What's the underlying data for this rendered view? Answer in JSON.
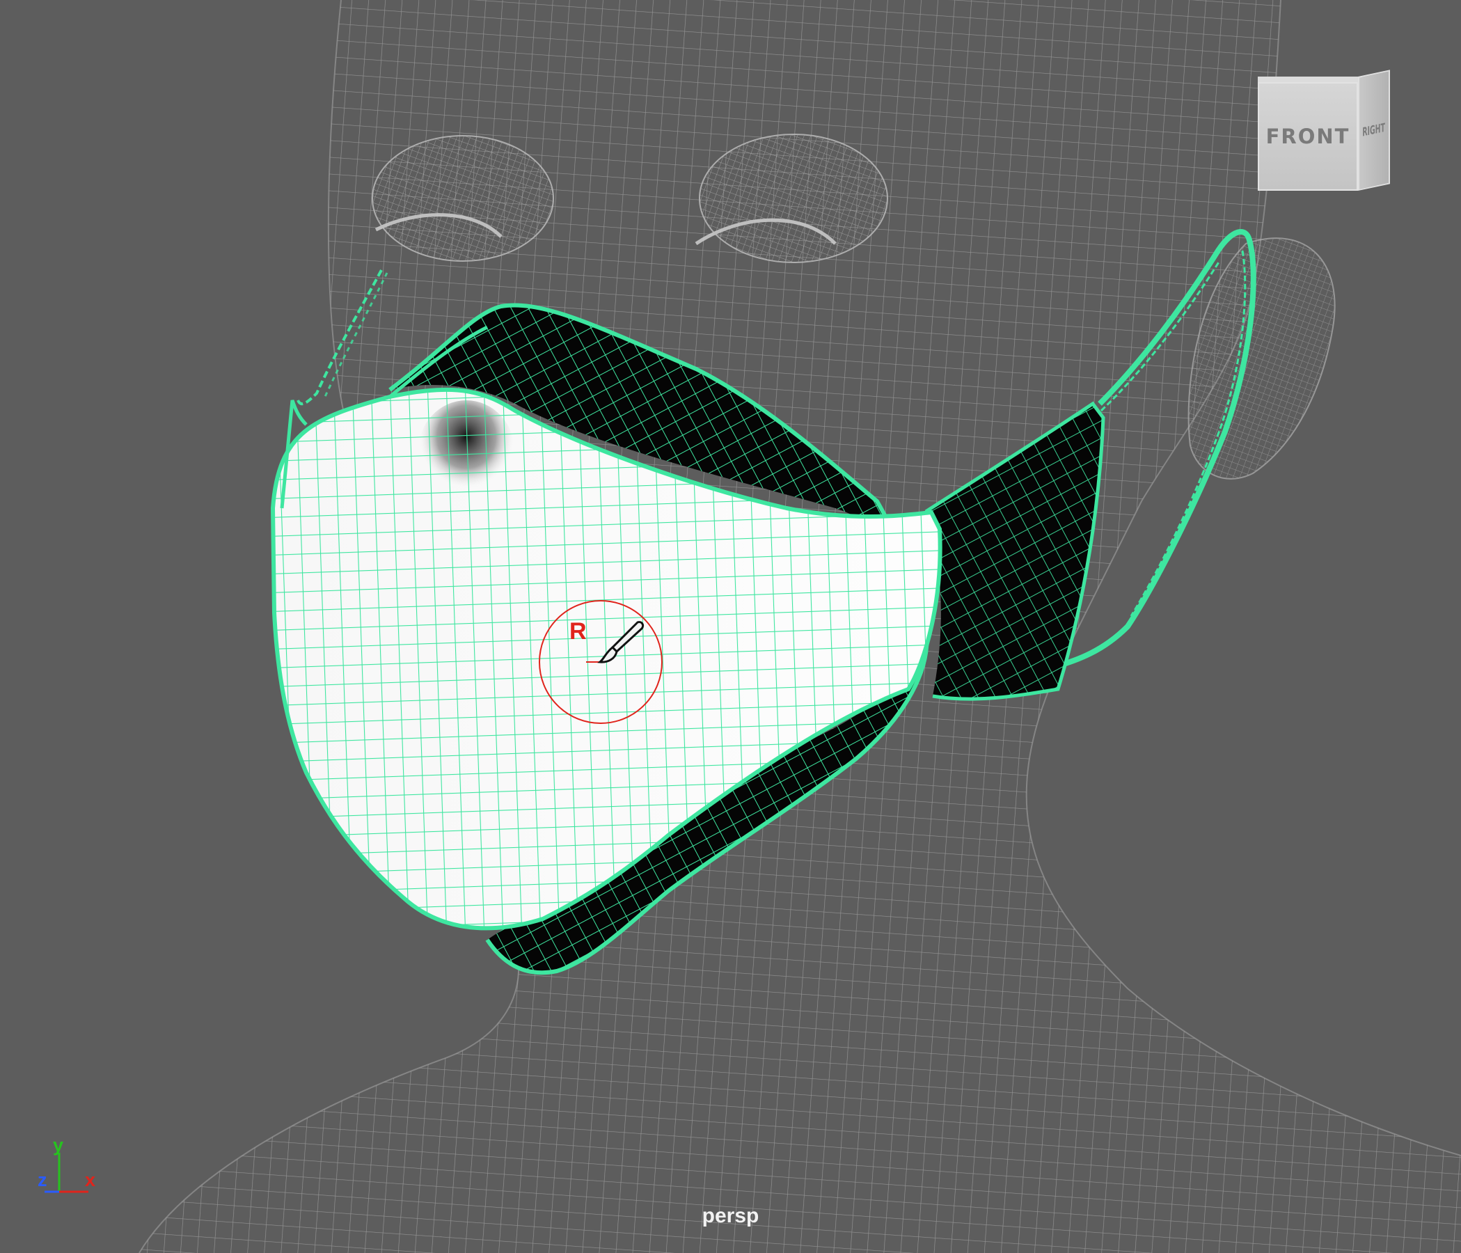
{
  "viewport": {
    "camera_name": "persp",
    "background_color": "#5d5d5d"
  },
  "view_cube": {
    "front_label": "FRONT",
    "right_label": "RIGHT"
  },
  "axis_gizmo": {
    "y_label": "y",
    "z_label": "z",
    "x_label": "x",
    "y_color": "#27c21f",
    "z_color": "#2a5cff",
    "x_color": "#e0241c"
  },
  "brush": {
    "mode_label": "R",
    "ring_color": "#e0241c",
    "icon": "paint-brush-icon"
  },
  "colors": {
    "selection_wireframe": "#3ee6a0",
    "reference_wireframe": "#9a9a9a"
  }
}
